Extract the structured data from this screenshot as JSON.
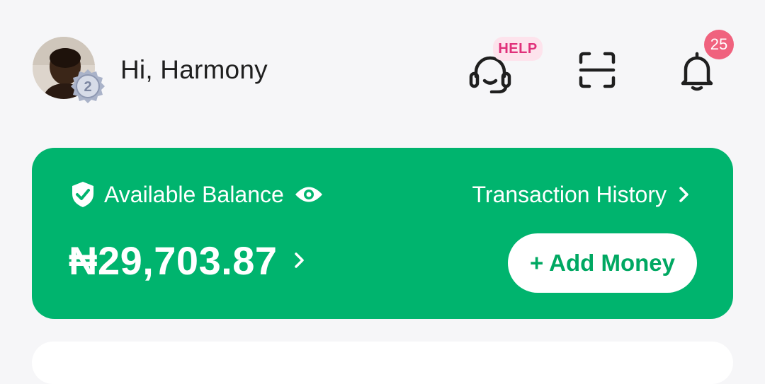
{
  "header": {
    "greeting": "Hi, Harmony",
    "avatar": {
      "icon": "user-photo",
      "level": "2"
    },
    "help": {
      "label": "HELP",
      "icon": "headset-icon"
    },
    "scan": {
      "icon": "scan-icon"
    },
    "notifications": {
      "icon": "bell-icon",
      "count": "25"
    }
  },
  "balance": {
    "label": "Available Balance",
    "amount": "₦29,703.87",
    "history_link": "Transaction History",
    "add_money": "+ Add Money"
  },
  "colors": {
    "brand_green": "#00b46e",
    "help_pink": "#e0307a",
    "badge_red": "#f0627e",
    "background": "#f6f6f8"
  }
}
